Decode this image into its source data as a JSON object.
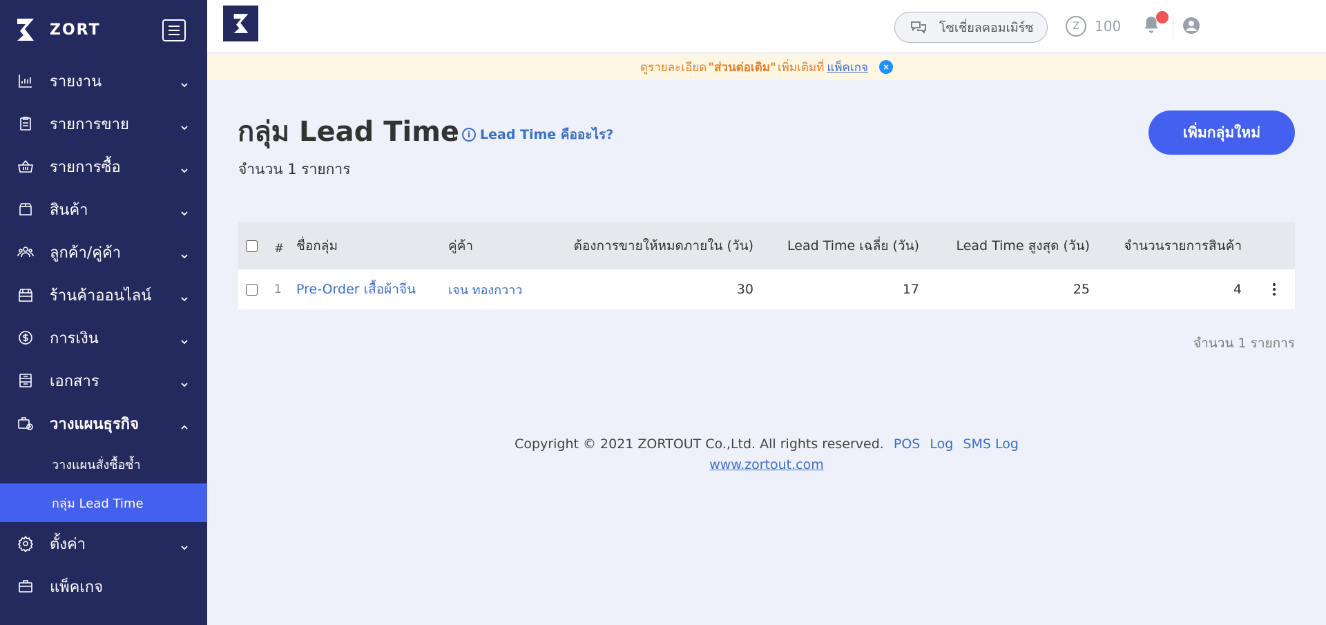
{
  "brand": {
    "name": "ZORT"
  },
  "sidebar": {
    "items": [
      {
        "label": "รายงาน",
        "icon": "bar-chart-icon"
      },
      {
        "label": "รายการขาย",
        "icon": "clipboard-icon"
      },
      {
        "label": "รายการซื้อ",
        "icon": "basket-icon"
      },
      {
        "label": "สินค้า",
        "icon": "box-icon"
      },
      {
        "label": "ลูกค้า/คู่ค้า",
        "icon": "users-icon"
      },
      {
        "label": "ร้านค้าออนไลน์",
        "icon": "store-icon"
      },
      {
        "label": "การเงิน",
        "icon": "dollar-icon"
      },
      {
        "label": "เอกสาร",
        "icon": "document-icon"
      },
      {
        "label": "วางแผนธุรกิจ",
        "icon": "planning-icon"
      },
      {
        "label": "ตั้งค่า",
        "icon": "gear-icon"
      },
      {
        "label": "แพ็คเกจ",
        "icon": "briefcase-icon"
      }
    ],
    "subitems": [
      {
        "label": "วางแผนสั่งซื้อซ้ำ"
      },
      {
        "label": "กลุ่ม Lead Time"
      }
    ]
  },
  "topbar": {
    "social_label": "โซเชี่ยลคอมเมิร์ซ",
    "credit_value": "100",
    "coin_symbol": "Z"
  },
  "banner": {
    "prefix": "ดูรายละเอียด",
    "highlight": "\"ส่วนต่อเติม\"",
    "middle": "เพิ่มเติมที่",
    "link": "แพ็คเกจ",
    "close": "×"
  },
  "main": {
    "title": "กลุ่ม Lead Time",
    "title_sep": "|",
    "help_label": "Lead Time คืออะไร?",
    "help_icon": "i",
    "count_text": "จำนวน 1 รายการ",
    "add_button": "เพิ่มกลุ่มใหม่",
    "bottom_count": "จำนวน 1 รายการ"
  },
  "table": {
    "headers": {
      "num": "#",
      "name": "ชื่อกลุ่ม",
      "partner": "คู่ค้า",
      "sell_within": "ต้องการขายให้หมดภายใน (วัน)",
      "avg_lead": "Lead Time เฉลี่ย (วัน)",
      "max_lead": "Lead Time สูงสุด (วัน)",
      "product_count": "จำนวนรายการสินค้า"
    },
    "rows": [
      {
        "num": "1",
        "name": "Pre-Order เสื้อผ้าจีน",
        "partner": "เจน ทองกวาว",
        "sell_within": "30",
        "avg_lead": "17",
        "max_lead": "25",
        "product_count": "4"
      }
    ]
  },
  "footer": {
    "copyright": "Copyright © 2021 ZORTOUT Co.,Ltd. All rights reserved.",
    "links": [
      "POS",
      "Log",
      "SMS Log"
    ],
    "website": "www.zortout.com"
  },
  "colors": {
    "sidebar": "#252a5e",
    "accent": "#4361ee",
    "link": "#3a6fc4",
    "banner_bg": "#fdf6e2"
  }
}
